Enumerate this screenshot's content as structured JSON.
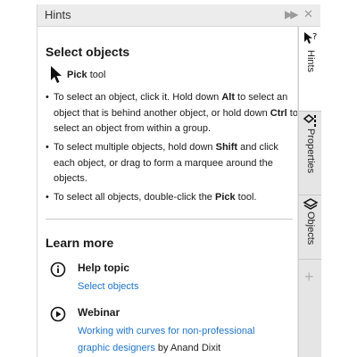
{
  "panel": {
    "title": "Hints",
    "icons": {
      "collapse": "double-chevron-right-icon",
      "close": "close-icon"
    }
  },
  "hint": {
    "heading": "Select objects",
    "tool_name": "Pick",
    "tool_suffix": " tool",
    "bullets": [
      {
        "parts": [
          "To select an object, click it. Hold down ",
          "Alt",
          " to select an object that is behind another object, or hold down ",
          "Ctrl",
          " to select an object from within a group."
        ]
      },
      {
        "parts": [
          "To select multiple objects, hold down ",
          "Shift",
          " and click each object, or drag to form a marquee around the objects."
        ]
      },
      {
        "parts": [
          "To select all objects, double-click the ",
          "Pick",
          " tool."
        ]
      }
    ]
  },
  "learn_more": {
    "heading": "Learn more",
    "help_topic": {
      "title": "Help topic",
      "link": "Select objects",
      "icon": "info-circle-icon"
    },
    "webinar": {
      "title": "Webinar",
      "link_line1": "Working with curves for non-professional",
      "link_line2": "graphic designers",
      "by": " by Anand Dixit",
      "icon": "play-circle-icon"
    }
  },
  "tabs": [
    {
      "label": "Hints",
      "icon": "cursor-question-icon",
      "active": true
    },
    {
      "label": "Properties",
      "icon": "properties-icon",
      "active": false
    },
    {
      "label": "Objects",
      "icon": "layers-icon",
      "active": false
    }
  ],
  "add_tab": {
    "label": "+"
  },
  "colors": {
    "link": "#1e73c7",
    "tabstrip": "#e5e5e5",
    "titlebar": "#ececec"
  }
}
